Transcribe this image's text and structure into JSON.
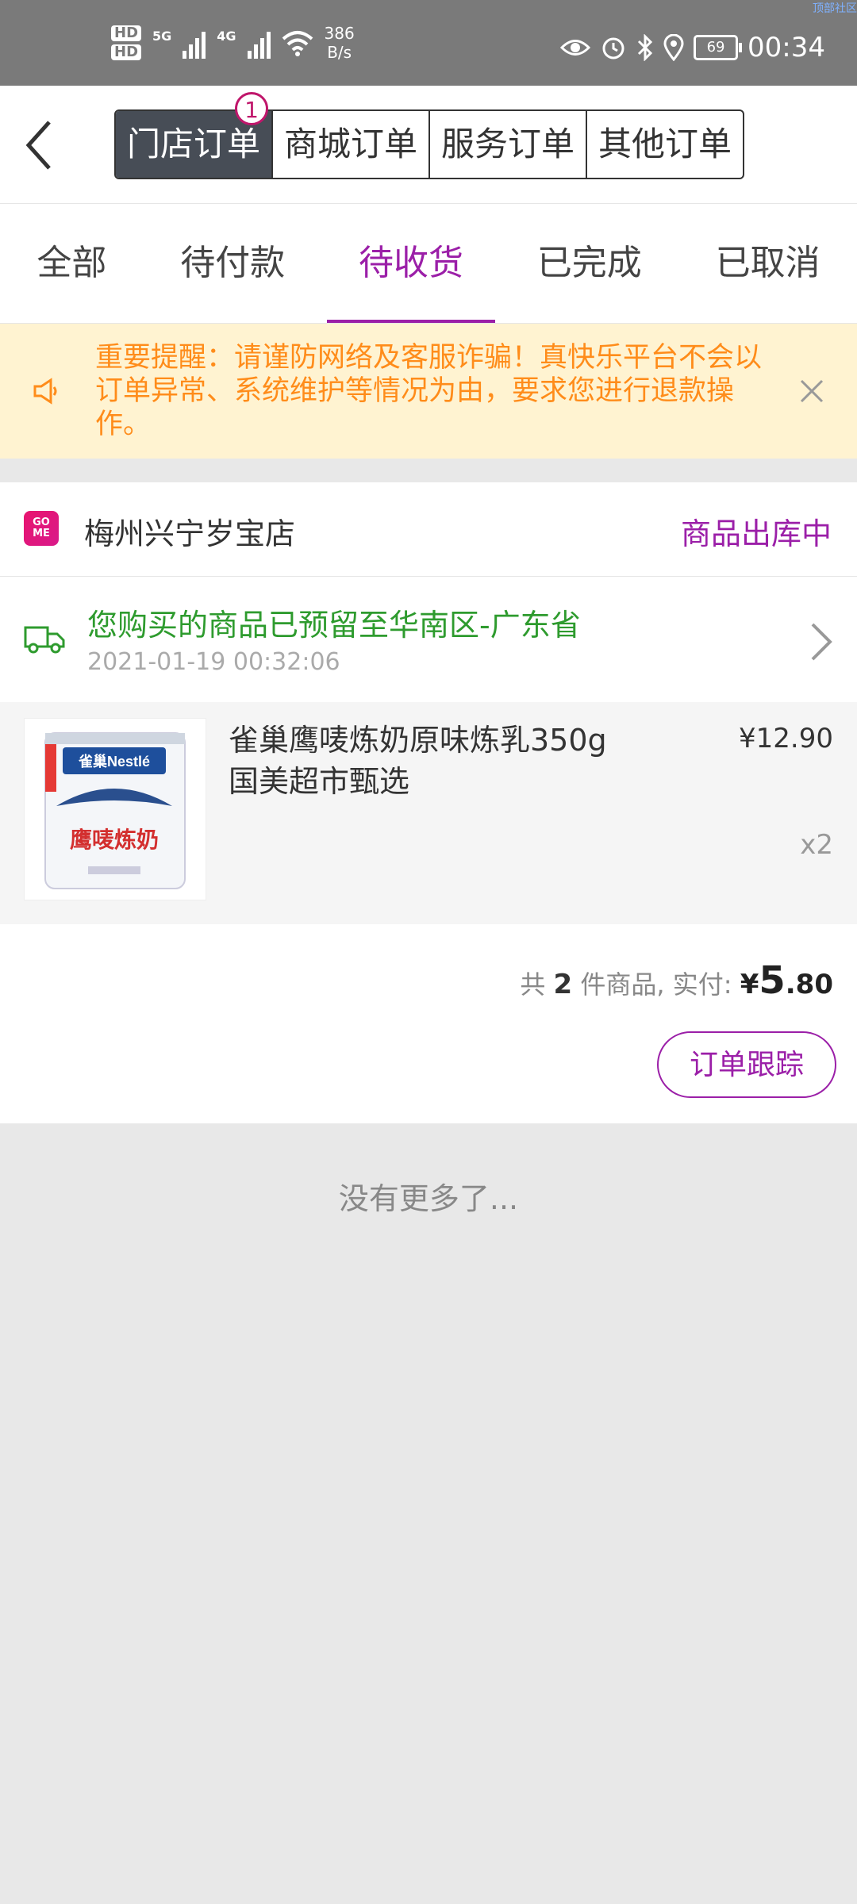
{
  "status_bar": {
    "hd1": "HD",
    "hd2": "HD",
    "net1": "5G",
    "net2": "4G",
    "speed_value": "386",
    "speed_unit": "B/s",
    "battery": "69",
    "time": "00:34",
    "corner_text": "顶部社区"
  },
  "header": {
    "segments": [
      "门店订单",
      "商城订单",
      "服务订单",
      "其他订单"
    ],
    "badge": "1"
  },
  "tabs": [
    "全部",
    "待付款",
    "待收货",
    "已完成",
    "已取消"
  ],
  "notice": {
    "text": "重要提醒：请谨防网络及客服诈骗！真快乐平台不会以订单异常、系统维护等情况为由，要求您进行退款操作。"
  },
  "order": {
    "store_logo": "GO ME",
    "store_name": "梅州兴宁岁宝店",
    "status": "商品出库中",
    "shipping_text": "您购买的商品已预留至华南区-广东省",
    "shipping_time": "2021-01-19 00:32:06",
    "product": {
      "name": "雀巢鹰唛炼奶原味炼乳350g 国美超市甄选",
      "price": "¥12.90",
      "qty": "x2",
      "image_brand": "雀巢Nestlé",
      "image_title": "鹰唛炼奶"
    },
    "summary_prefix": "共",
    "count": "2",
    "summary_middle": "件商品, 实付:",
    "currency": "¥",
    "amount_int": "5",
    "amount_dec": ".80",
    "track_button": "订单跟踪"
  },
  "footer_text": "没有更多了...",
  "colors": {
    "accent": "#9b1fa8",
    "notice_bg": "#fff3d1",
    "notice_text": "#ff8c1a",
    "ship_green": "#2e9b2e"
  }
}
